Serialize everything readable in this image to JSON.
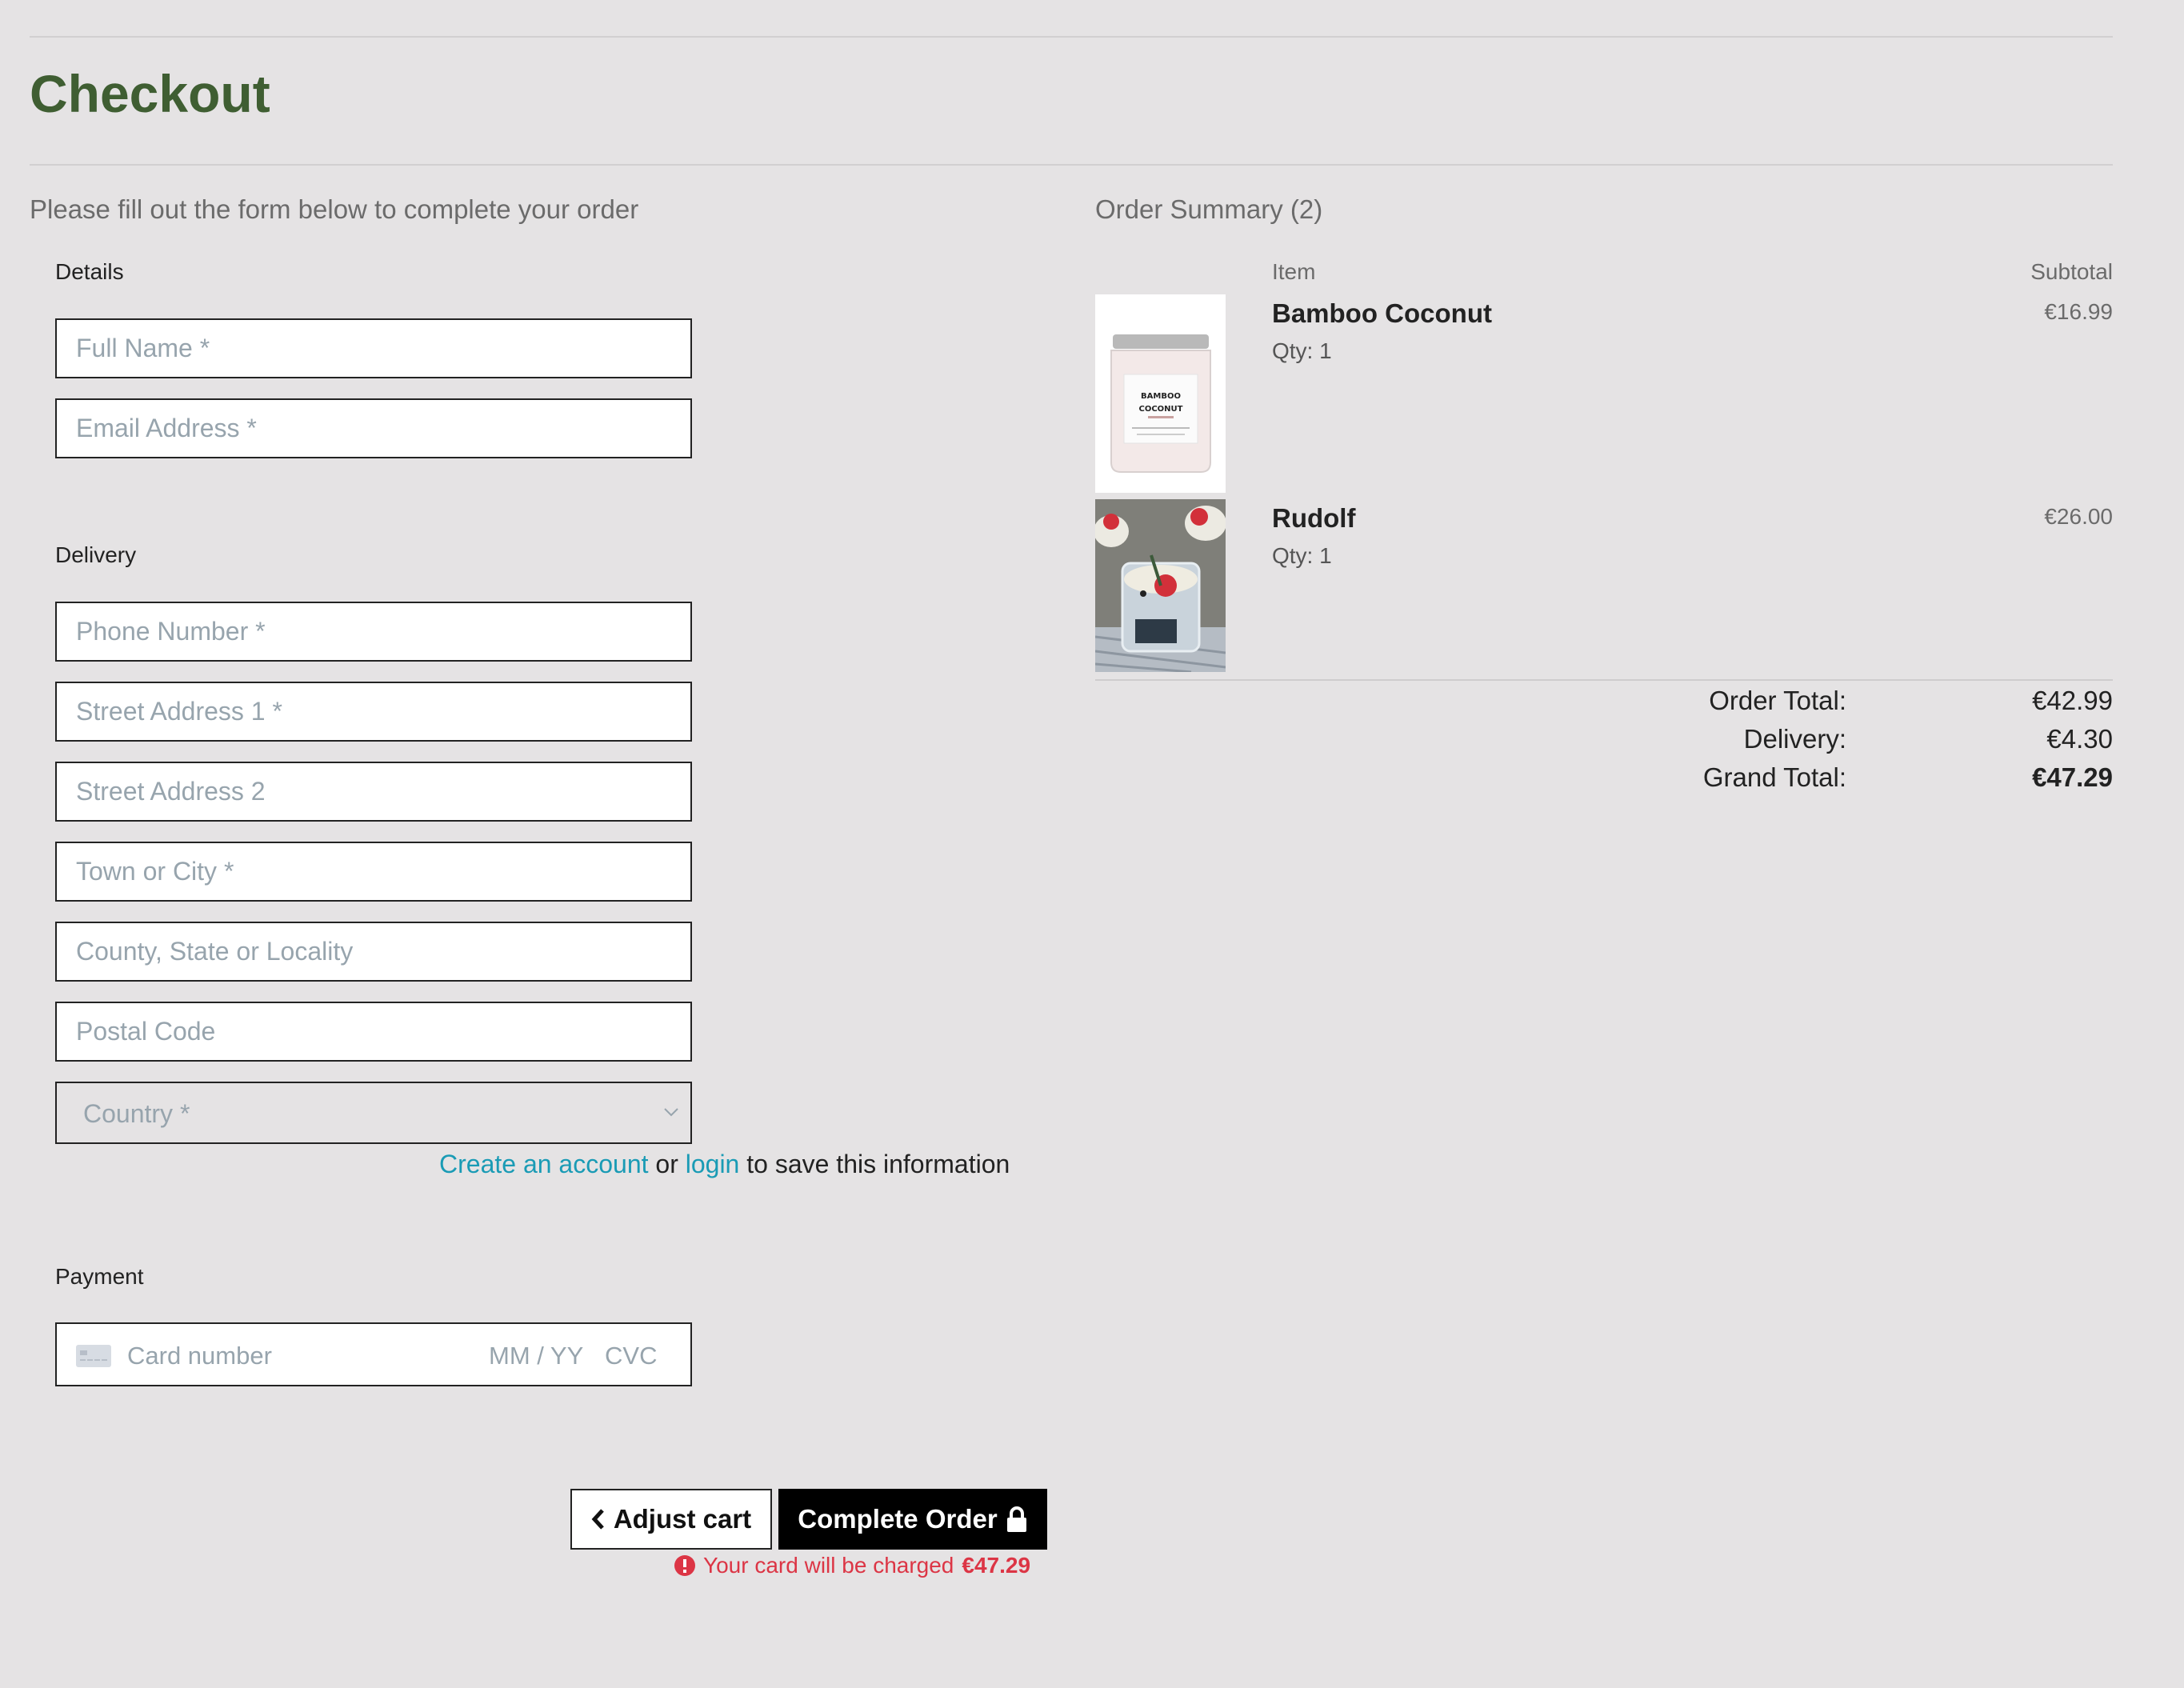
{
  "page": {
    "title": "Checkout",
    "intro": "Please fill out the form below to complete your order"
  },
  "form": {
    "details_label": "Details",
    "delivery_label": "Delivery",
    "payment_label": "Payment",
    "full_name_placeholder": "Full Name *",
    "email_placeholder": "Email Address *",
    "phone_placeholder": "Phone Number *",
    "street1_placeholder": "Street Address 1 *",
    "street2_placeholder": "Street Address 2",
    "town_placeholder": "Town or City *",
    "county_placeholder": "County, State or Locality",
    "postcode_placeholder": "Postal Code",
    "country_value": "Country *",
    "save_info": {
      "create_link": "Create an account",
      "or": "or",
      "login_link": "login",
      "suffix": "to save this information"
    },
    "card": {
      "number_placeholder": "Card number",
      "expiry_placeholder": "MM / YY",
      "cvc_placeholder": "CVC"
    }
  },
  "actions": {
    "adjust_label": "Adjust cart",
    "complete_label": "Complete Order",
    "charge_notice": "Your card will be charged",
    "charge_amount": "€47.29"
  },
  "summary": {
    "heading": "Order Summary (2)",
    "col_item": "Item",
    "col_subtotal": "Subtotal",
    "items": [
      {
        "name": "Bamboo Coconut",
        "qty": "Qty: 1",
        "price": "€16.99",
        "image_label_1": "BAMBOO",
        "image_label_2": "COCONUT"
      },
      {
        "name": "Rudolf",
        "qty": "Qty: 1",
        "price": "€26.00"
      }
    ],
    "order_total_label": "Order Total:",
    "order_total": "€42.99",
    "delivery_label": "Delivery:",
    "delivery": "€4.30",
    "grand_total_label": "Grand Total:",
    "grand_total": "€47.29"
  },
  "colors": {
    "title": "#3f5e32",
    "link": "#1a9bb5",
    "error": "#dc3545",
    "background": "#e5e3e4"
  }
}
